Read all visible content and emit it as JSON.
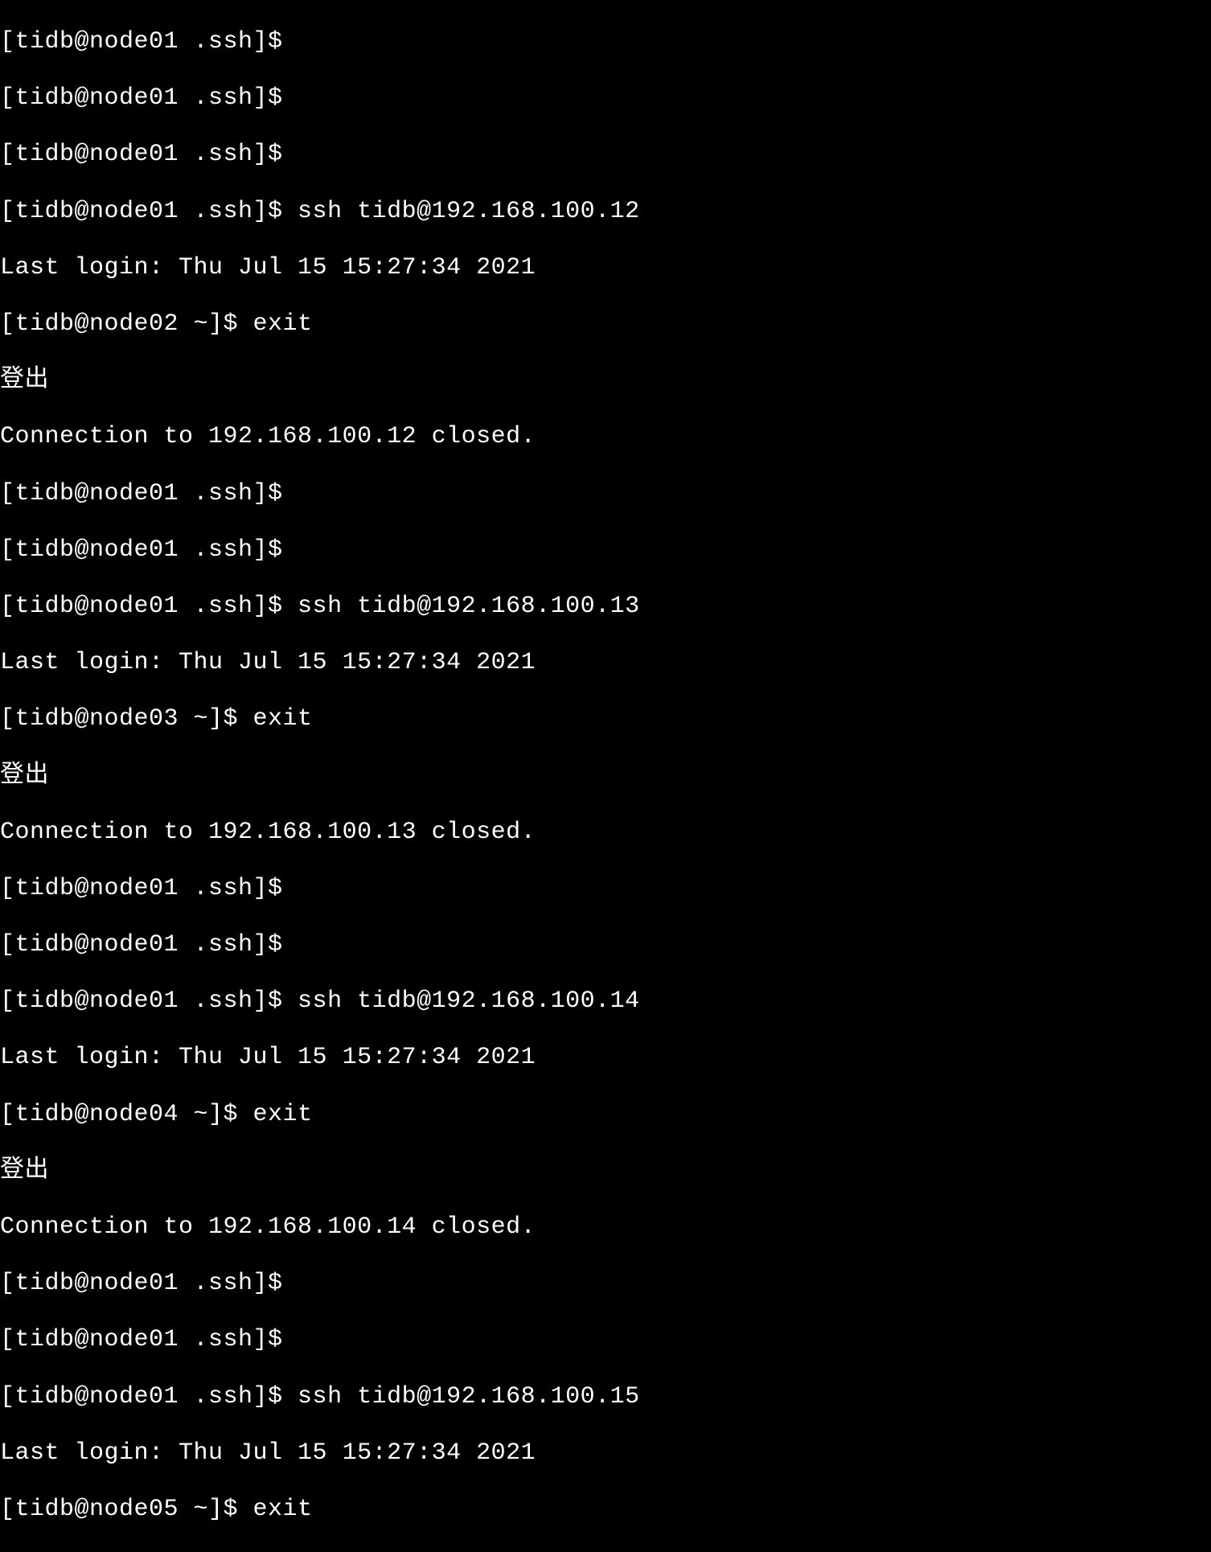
{
  "terminal": {
    "lines": [
      "[tidb@node01 .ssh]$",
      "[tidb@node01 .ssh]$",
      "[tidb@node01 .ssh]$",
      "[tidb@node01 .ssh]$ ssh tidb@192.168.100.12",
      "Last login: Thu Jul 15 15:27:34 2021",
      "[tidb@node02 ~]$ exit",
      "登出",
      "Connection to 192.168.100.12 closed.",
      "[tidb@node01 .ssh]$",
      "[tidb@node01 .ssh]$",
      "[tidb@node01 .ssh]$ ssh tidb@192.168.100.13",
      "Last login: Thu Jul 15 15:27:34 2021",
      "[tidb@node03 ~]$ exit",
      "登出",
      "Connection to 192.168.100.13 closed.",
      "[tidb@node01 .ssh]$",
      "[tidb@node01 .ssh]$",
      "[tidb@node01 .ssh]$ ssh tidb@192.168.100.14",
      "Last login: Thu Jul 15 15:27:34 2021",
      "[tidb@node04 ~]$ exit",
      "登出",
      "Connection to 192.168.100.14 closed.",
      "[tidb@node01 .ssh]$",
      "[tidb@node01 .ssh]$",
      "[tidb@node01 .ssh]$ ssh tidb@192.168.100.15",
      "Last login: Thu Jul 15 15:27:34 2021",
      "[tidb@node05 ~]$ exit"
    ]
  }
}
